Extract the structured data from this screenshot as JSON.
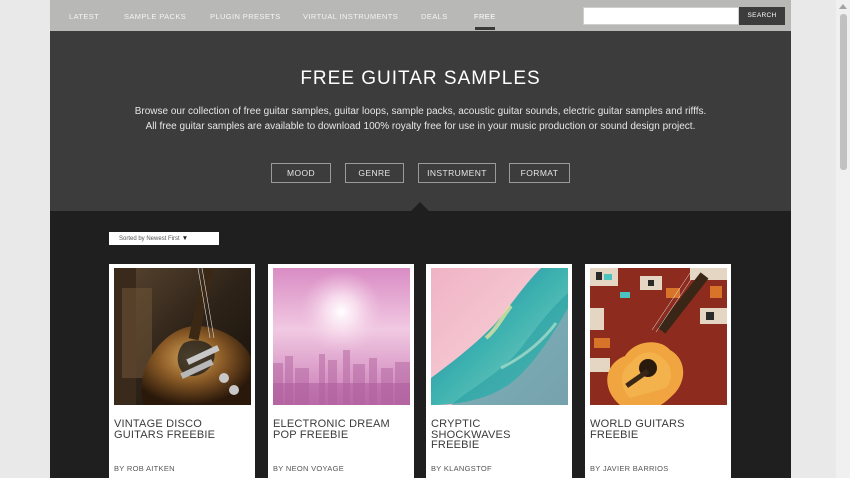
{
  "nav": {
    "items": [
      {
        "label": "LATEST"
      },
      {
        "label": "SAMPLE PACKS"
      },
      {
        "label": "PLUGIN PRESETS"
      },
      {
        "label": "VIRTUAL INSTRUMENTS"
      },
      {
        "label": "DEALS"
      },
      {
        "label": "FREE",
        "active": true
      }
    ],
    "search_placeholder": "",
    "search_button": "SEARCH"
  },
  "hero": {
    "title": "FREE GUITAR SAMPLES",
    "description_line1": "Browse our collection of free guitar samples, guitar loops, sample packs, acoustic guitar sounds, electric guitar samples and rifffs.",
    "description_line2": "All free guitar samples are available to download 100% royalty free for use in your music production or sound design project.",
    "filters": [
      "MOOD",
      "GENRE",
      "INSTRUMENT",
      "FORMAT"
    ]
  },
  "sort": {
    "label": "Sorted by Newest First",
    "arrow": "▼"
  },
  "cards": [
    {
      "title": "VINTAGE DISCO GUITARS FREEBIE",
      "author": "BY ROB AITKEN",
      "image": "electric-guitar-photo"
    },
    {
      "title": "ELECTRONIC DREAM POP FREEBIE",
      "author": "BY NEON VOYAGE",
      "image": "pink-city-skyline-photo"
    },
    {
      "title": "CRYPTIC SHOCKWAVES FREEBIE",
      "author": "BY KLANGSTOF",
      "image": "pink-teal-abstract-photo"
    },
    {
      "title": "WORLD GUITARS FREEBIE",
      "author": "BY JAVIER BARRIOS",
      "image": "acoustic-guitar-rug-photo"
    }
  ],
  "colors": {
    "nav_bg": "#b8b8b6",
    "hero_bg": "#3c3c3c",
    "page_bg": "#1f1f1f",
    "card_bg": "#ffffff"
  }
}
